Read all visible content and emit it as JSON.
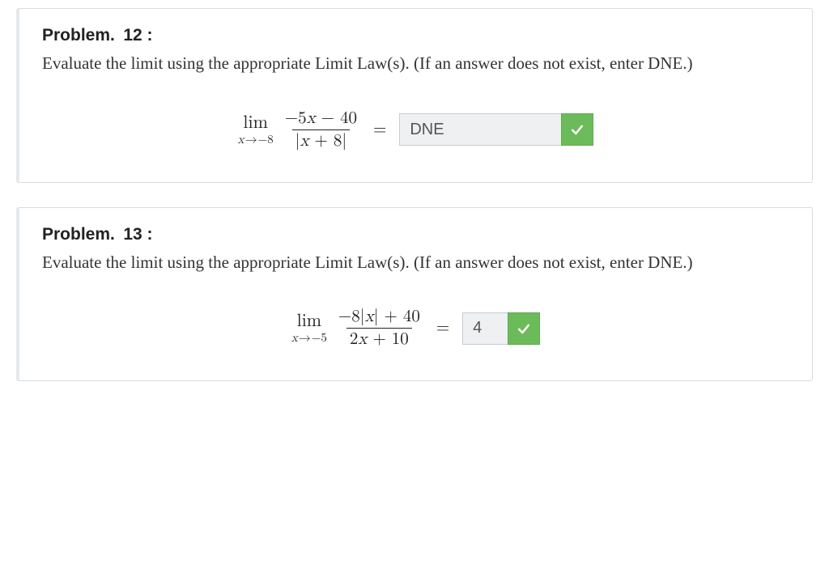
{
  "problems": [
    {
      "label": "Problem.",
      "number": "12 :",
      "prompt": "Evaluate the limit using the appropriate Limit Law(s). (If an answer does not exist, enter DNE.)",
      "limit": {
        "lim_word": "lim",
        "var": "x",
        "approach": "−8",
        "numerator_prefix": "−5",
        "numerator_suffix": " − 40",
        "denominator_prefix": "|",
        "denominator_suffix": " + 8|"
      },
      "equals": "=",
      "answer": "DNE",
      "correct": true
    },
    {
      "label": "Problem.",
      "number": "13 :",
      "prompt": "Evaluate the limit using the appropriate Limit Law(s). (If an answer does not exist, enter DNE.)",
      "limit": {
        "lim_word": "lim",
        "var": "x",
        "approach": "−5",
        "numerator_prefix": "−8|",
        "numerator_suffix": "| + 40",
        "denominator_prefix": "2",
        "denominator_suffix": " + 10"
      },
      "equals": "=",
      "answer": "4",
      "correct": true
    }
  ]
}
